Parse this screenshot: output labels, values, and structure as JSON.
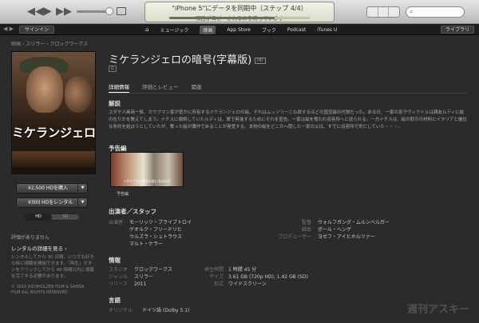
{
  "toolbar": {
    "lcd_line1": "\"iPhone 5\"にデータを同期中（ステップ 4/4）",
    "lcd_line2": "項目がコピーされるのを待っています",
    "lcd_progress_fraction": 0.75,
    "search_placeholder": "",
    "library_label": "ライブラリ"
  },
  "navbar": {
    "signin_label": "サインイン",
    "items": [
      "⌂",
      "ミュージック",
      "映画",
      "App Store",
      "ブック",
      "Podcast",
      "iTunes U"
    ],
    "active_index": 2
  },
  "breadcrumb": "映画 › スリラー › クロックワークス",
  "movie": {
    "title": "ミケランジェロの暗号(字幕版)",
    "hd_badge": "HD",
    "rating_badge": "G",
    "poster_title": "ミケランジェロの暗号",
    "buy_label": "¥2,500 HDを購入",
    "rent_label": "¥300 HDをレンタル",
    "quality_options": [
      "HD",
      "SD"
    ],
    "quality_selected": "HD",
    "no_rating": "評価がありません",
    "rent_details_link": "レンタルの詳細を見る ›",
    "rent_note": "レンタルしてから 30 日間、いつでも好きな時に視聴を開始できます。「再生」ボタンをクリックしてから 48 時間以内に視聴を完了する必要があります。",
    "copyright": "© 2010 AICHHOLZER FILM & SAMSA FILM ALL RIGHTS RESERVED"
  },
  "tabs": [
    {
      "label": "詳細情報",
      "active": true
    },
    {
      "label": "評価とレビュー",
      "active": false
    },
    {
      "label": "関連",
      "active": false
    }
  ],
  "description": {
    "heading": "解説",
    "text": "ユダヤ人画商一族、カウフマン家が密かに所有するミケランジェロの絵。それはムッソリーニも欲するほどの国宝級の代物だった。ある日、一家の息子ヴィクトルは親友ルディに絵の在りかを教えてしまう。ナチスに傾倒していたルディは、軍で昇進するためにそれを密告。一家は絵を奪われ収容所へと送られる。一方ナチスは、絵の取引の材料にイタリアと優位な条約を結ぼうとしていたが、奪った絵が贋作であることが発覚する。本物の絵をどこかへ隠した一家の父は、すでに収容所で死亡していた・・・。"
  },
  "trailer": {
    "heading": "予告編",
    "subtitle": "イタリアとの友好の証になるのだ",
    "label": "予告編"
  },
  "cast": {
    "heading": "出演者／スタッフ",
    "actors_label": "出演者",
    "actors": [
      "モーリッツ・ブライブトロイ",
      "ゲオルク・フリードリヒ",
      "ウルズラ・シュトラウス",
      "マルト・ケラー"
    ],
    "director_label": "監督",
    "director": "ウォルフガング・ムルンベルガー",
    "writer_label": "脚本",
    "writer": "ポール・ヘンゲ",
    "producer_label": "プロデューサー",
    "producer": "ヨゼフ・アイヒホルツァー"
  },
  "info": {
    "heading": "情報",
    "studio_label": "スタジオ",
    "studio": "クロックワークス",
    "genre_label": "ジャンル",
    "genre": "スリラー",
    "release_label": "リリース",
    "release": "2011",
    "runtime_label": "再生時間",
    "runtime": "1 時間 45 分",
    "size_label": "サイズ",
    "size": "3.61 GB (720p HD), 1.42 GB (SD)",
    "format_label": "形式",
    "format": "ワイドスクリーン"
  },
  "language": {
    "heading": "言語",
    "original_label": "オリジナル",
    "original": "ドイツ語 (Dolby 5.1)"
  },
  "watermark": "週刊アスキー"
}
